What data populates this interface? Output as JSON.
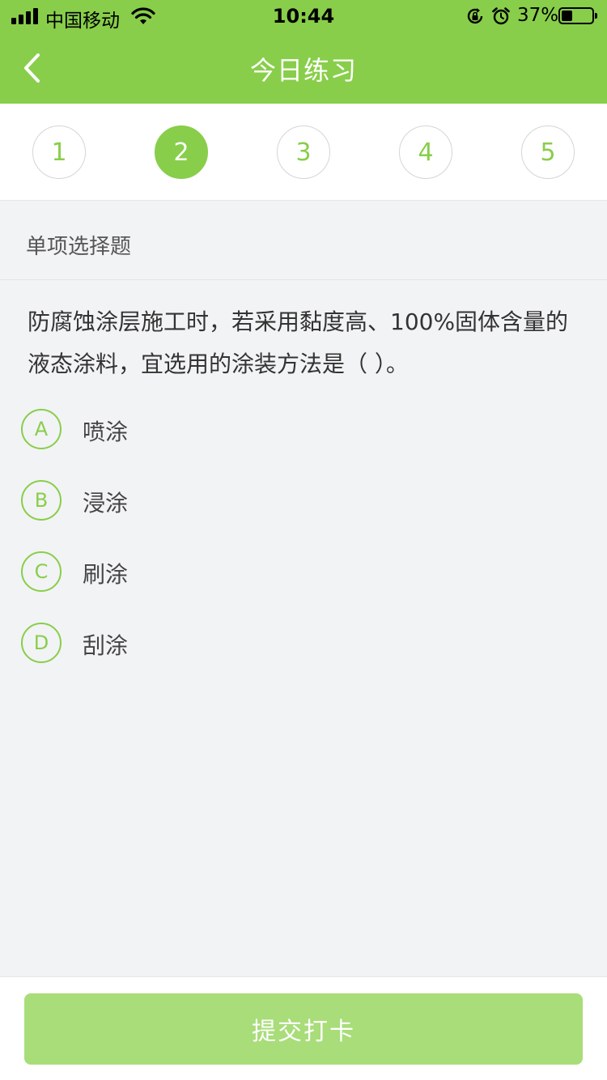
{
  "status_bar": {
    "carrier": "中国移动",
    "time": "10:44",
    "battery_percent": "37%",
    "battery_level": 0.37,
    "icons": [
      "signal-icon",
      "wifi-icon",
      "rotation-lock-icon",
      "alarm-icon",
      "battery-icon"
    ]
  },
  "nav": {
    "title": "今日练习",
    "back_icon": "chevron-left-icon"
  },
  "question_numbers": {
    "items": [
      "1",
      "2",
      "3",
      "4",
      "5"
    ],
    "active": "2"
  },
  "question": {
    "type": "单项选择题",
    "text": "防腐蚀涂层施工时，若采用黏度高、100%固体含量的液态涂料，宜选用的涂装方法是（    ）。",
    "options": [
      {
        "letter": "A",
        "text": "喷涂"
      },
      {
        "letter": "B",
        "text": "浸涂"
      },
      {
        "letter": "C",
        "text": "刷涂"
      },
      {
        "letter": "D",
        "text": "刮涂"
      }
    ]
  },
  "footer": {
    "submit_label": "提交打卡"
  },
  "colors": {
    "accent": "#88ce4a",
    "submit_disabled": "#a8dd79",
    "background": "#f2f3f5"
  }
}
